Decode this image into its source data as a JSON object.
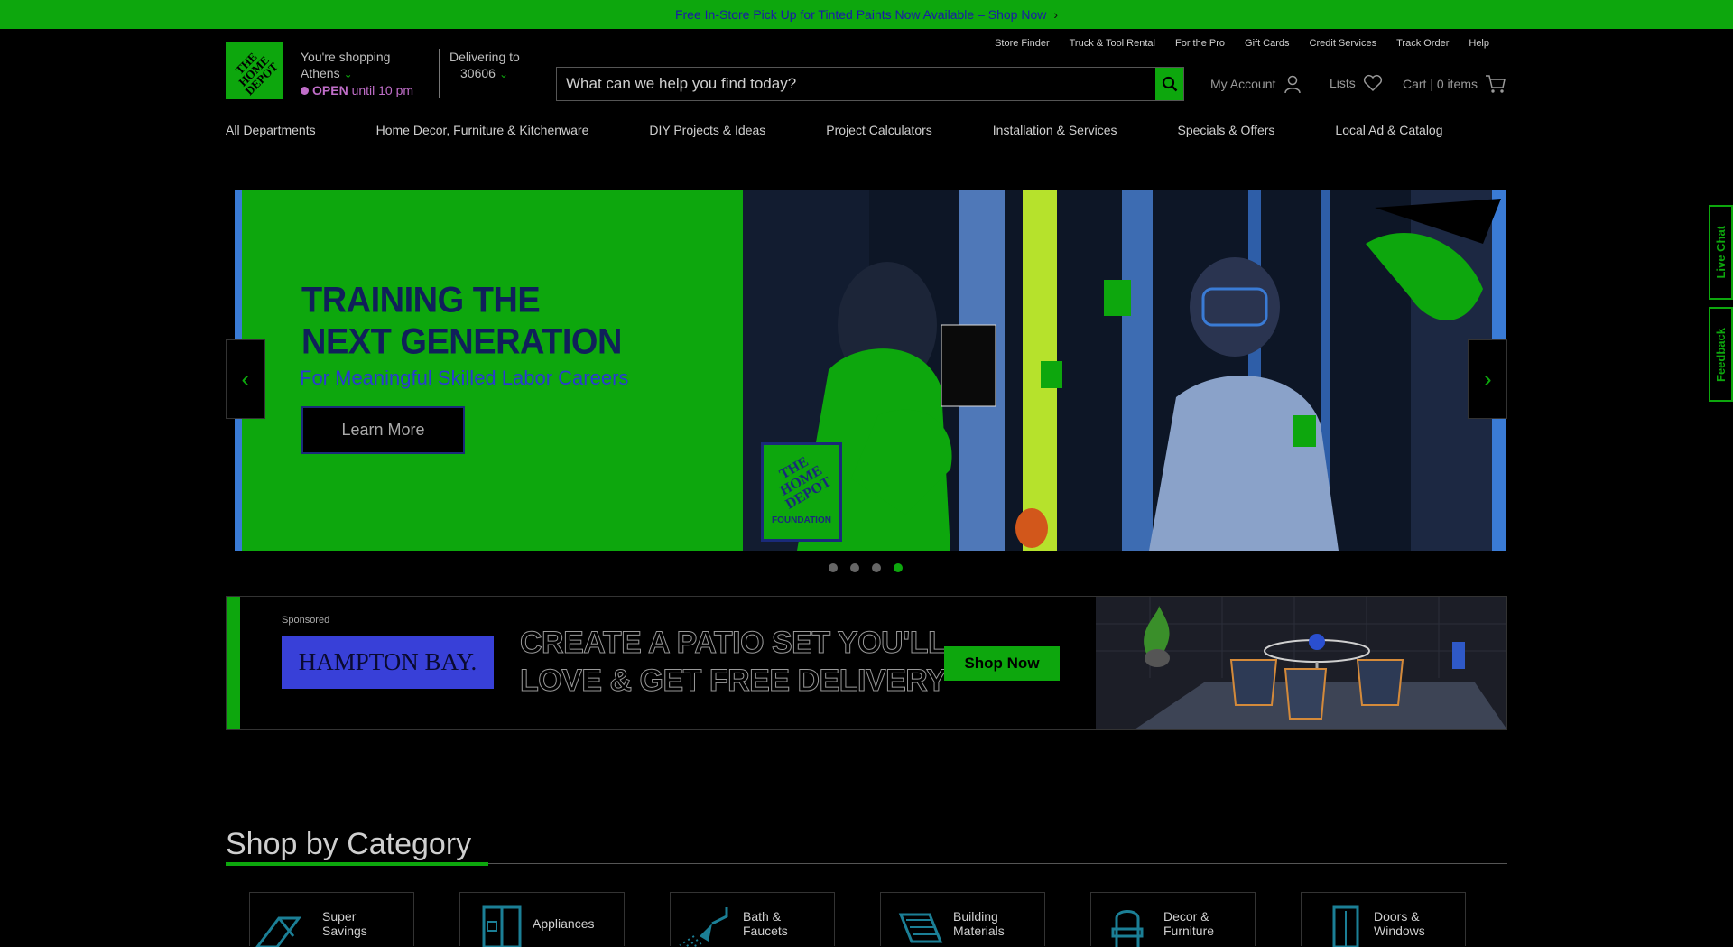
{
  "promo": {
    "text": "Free In-Store Pick Up for Tinted Paints Now Available – Shop Now",
    "chevron": "›"
  },
  "logo": {
    "text": "THE HOME DEPOT"
  },
  "store": {
    "line1": "You're shopping",
    "city": "Athens",
    "open": "OPEN",
    "until": "until 10 pm"
  },
  "delivery": {
    "line1": "Delivering to",
    "zip": "30606"
  },
  "util_links": [
    "Store Finder",
    "Truck & Tool Rental",
    "For the Pro",
    "Gift Cards",
    "Credit Services",
    "Track Order",
    "Help"
  ],
  "search": {
    "placeholder": "What can we help you find today?"
  },
  "account": {
    "label": "My Account"
  },
  "lists": {
    "label": "Lists"
  },
  "cart": {
    "label": "Cart | 0 items"
  },
  "nav": [
    "All Departments",
    "Home Decor, Furniture & Kitchenware",
    "DIY Projects & Ideas",
    "Project Calculators",
    "Installation & Services",
    "Specials & Offers",
    "Local Ad & Catalog"
  ],
  "hero": {
    "title_line1": "TRAINING THE",
    "title_line2": "NEXT GENERATION",
    "subtitle": "For Meaningful Skilled Labor Careers",
    "button": "Learn More",
    "badge_text": "THE HOME DEPOT",
    "badge_sub": "FOUNDATION",
    "slides": 4,
    "active_slide": 4
  },
  "ad": {
    "sponsored": "Sponsored",
    "brand": "HAMPTON BAY.",
    "headline_line1": "CREATE A PATIO SET YOU'LL",
    "headline_line2": "LOVE & GET FREE DELIVERY",
    "button": "Shop Now"
  },
  "side_tabs": {
    "live_chat": "Live Chat",
    "feedback": "Feedback"
  },
  "category_section": {
    "title": "Shop by Category",
    "items": [
      {
        "line1": "Super",
        "line2": "Savings",
        "icon": "tag-icon"
      },
      {
        "line1": "Appliances",
        "line2": "",
        "icon": "fridge-icon"
      },
      {
        "line1": "Bath &",
        "line2": "Faucets",
        "icon": "shower-icon"
      },
      {
        "line1": "Building",
        "line2": "Materials",
        "icon": "lumber-icon"
      },
      {
        "line1": "Decor &",
        "line2": "Furniture",
        "icon": "chair-icon"
      },
      {
        "line1": "Doors &",
        "line2": "Windows",
        "icon": "door-icon"
      }
    ]
  },
  "colors": {
    "brand_green": "#0da70d",
    "background": "#000000",
    "accent_blue": "#2a3bd0"
  }
}
